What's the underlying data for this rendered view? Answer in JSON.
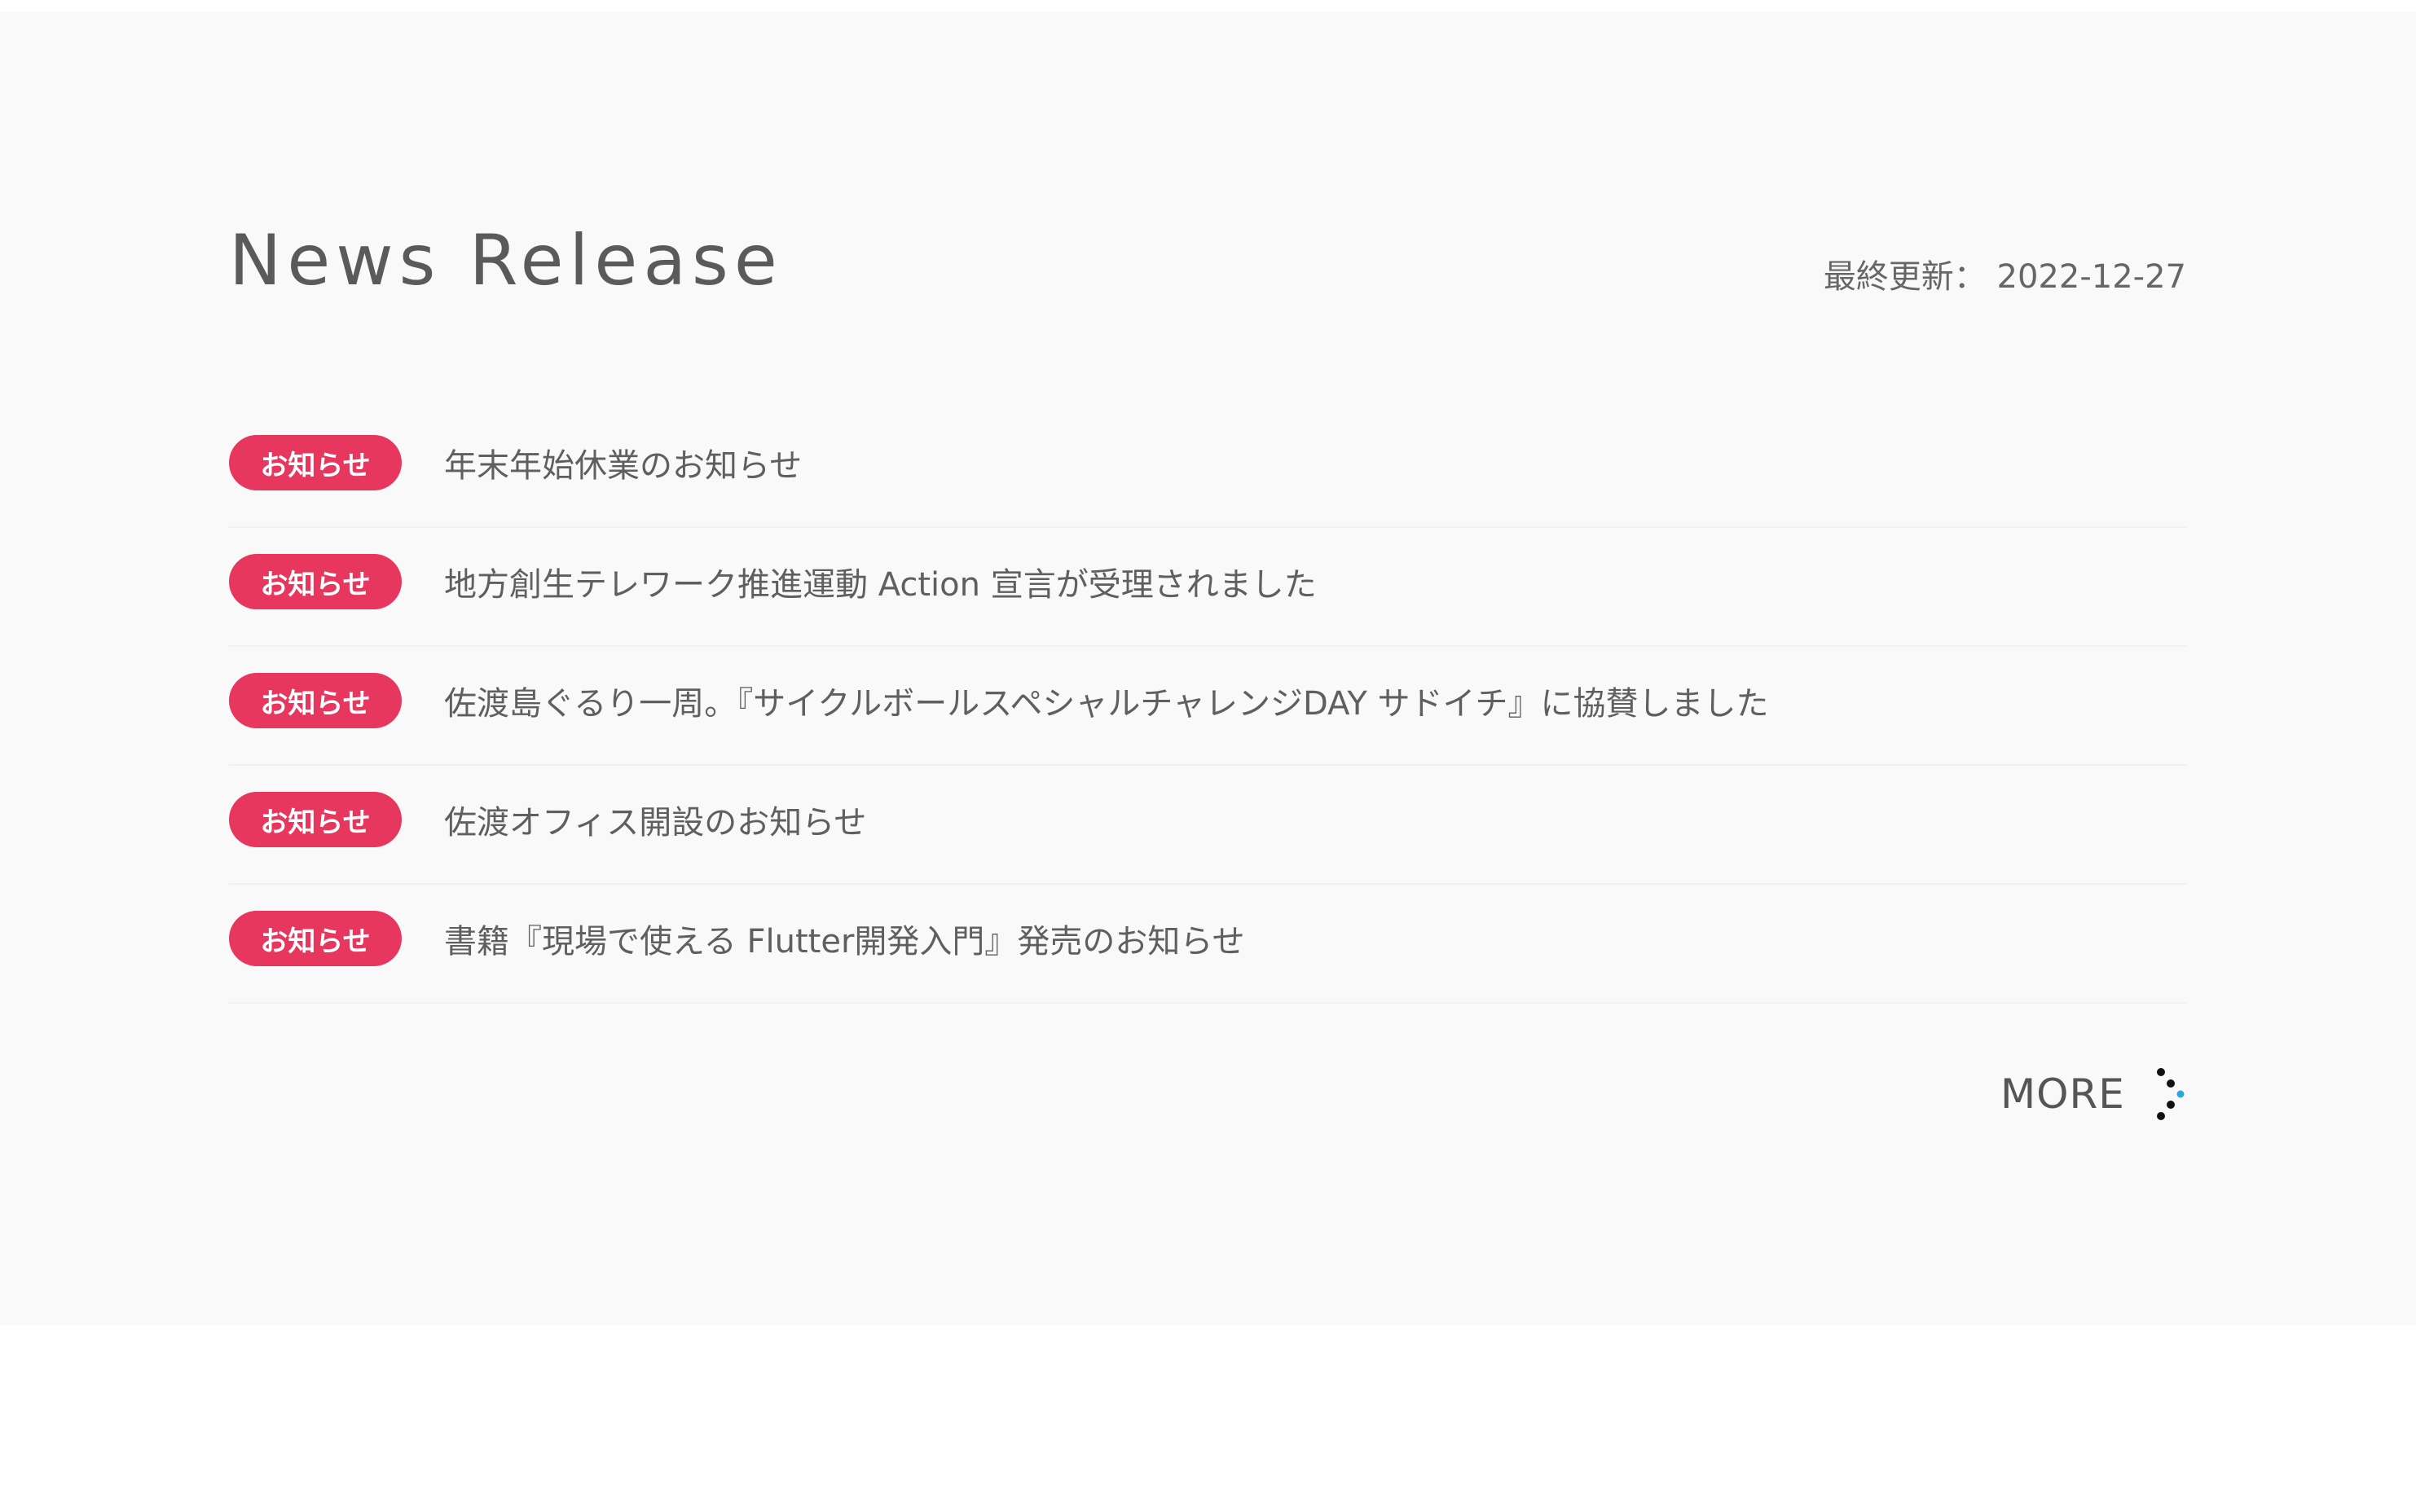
{
  "section": {
    "title": "News Release",
    "last_updated": "最終更新： 2022-12-27"
  },
  "news": [
    {
      "badge": "お知らせ",
      "title": "年末年始休業のお知らせ"
    },
    {
      "badge": "お知らせ",
      "title": "地方創生テレワーク推進運動 Action 宣言が受理されました"
    },
    {
      "badge": "お知らせ",
      "title": "佐渡島ぐるり一周。『サイクルボールスペシャルチャレンジDAY サドイチ』に協賛しました"
    },
    {
      "badge": "お知らせ",
      "title": "佐渡オフィス開設のお知らせ"
    },
    {
      "badge": "お知らせ",
      "title": "書籍『現場で使える Flutter開発入門』発売のお知らせ"
    }
  ],
  "more": {
    "label": "MORE",
    "icon": "dotted-chevron-right-icon"
  },
  "colors": {
    "badge": "#e8375e",
    "text": "#5f5f5f",
    "section_background": "#f9f9f9",
    "icon_accent": "#29a8e0"
  }
}
